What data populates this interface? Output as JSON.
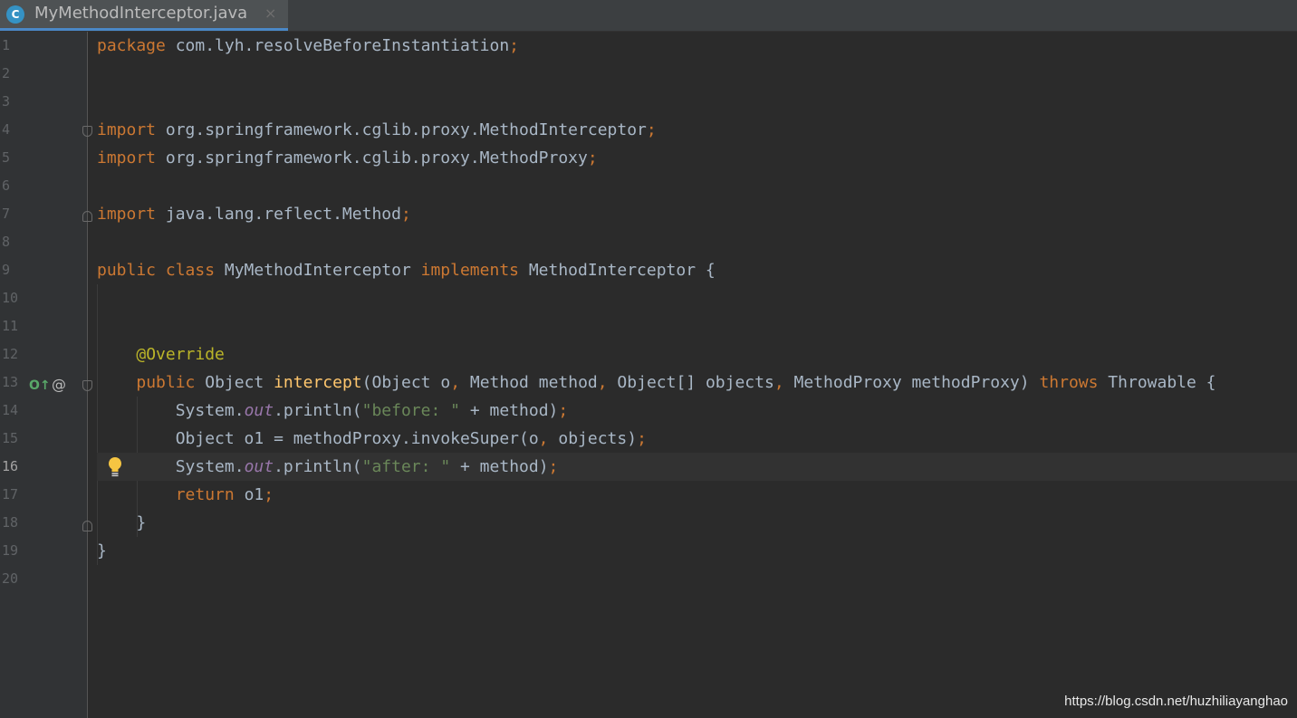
{
  "tab": {
    "icon": "C",
    "title": "MyMethodInterceptor.java",
    "close": "×"
  },
  "gutter": {
    "line_numbers": [
      "1",
      "2",
      "3",
      "4",
      "5",
      "6",
      "7",
      "8",
      "9",
      "10",
      "11",
      "12",
      "13",
      "14",
      "15",
      "16",
      "17",
      "18",
      "19",
      "20"
    ],
    "current_line": "16",
    "override_marker": "O↑",
    "annotation_marker": "@"
  },
  "code": {
    "line1": {
      "kw": "package",
      "rest": " com.lyh.resolveBeforeInstantiation",
      "semi": ";"
    },
    "line4": {
      "kw": "import",
      "rest": " org.springframework.cglib.proxy.MethodInterceptor",
      "semi": ";"
    },
    "line5": {
      "kw": "import",
      "rest": " org.springframework.cglib.proxy.MethodProxy",
      "semi": ";"
    },
    "line7": {
      "kw": "import",
      "rest": " java.lang.reflect.Method",
      "semi": ";"
    },
    "line9": {
      "kw1": "public class",
      "name": " MyMethodInterceptor ",
      "kw2": "implements",
      "rest": " MethodInterceptor {"
    },
    "line12": {
      "ann": "@Override"
    },
    "line13": {
      "kw1": "public",
      "t1": " Object ",
      "fn": "intercept",
      "t2": "(Object o",
      "c1": ",",
      "t3": " Method method",
      "c2": ",",
      "t4": " Object[] objects",
      "c3": ",",
      "t5": " MethodProxy methodProxy) ",
      "kw2": "throws",
      "t6": " Throwable {"
    },
    "line14": {
      "t1": "System.",
      "st": "out",
      "t2": ".println(",
      "str": "\"before: \"",
      "t3": " + method)",
      "semi": ";"
    },
    "line15": {
      "t1": "Object o1 = methodProxy.invokeSuper(o",
      "c1": ",",
      "t2": " objects)",
      "semi": ";"
    },
    "line16": {
      "t1": "System.",
      "st": "out",
      "t2": ".println(",
      "str": "\"after: \"",
      "t3": " + method)",
      "semi": ";"
    },
    "line17": {
      "kw": "return",
      "t1": " o1",
      "semi": ";"
    },
    "line18": {
      "t1": "}"
    },
    "line19": {
      "t1": "}"
    }
  },
  "watermark": "https://blog.csdn.net/huzhiliayanghao"
}
